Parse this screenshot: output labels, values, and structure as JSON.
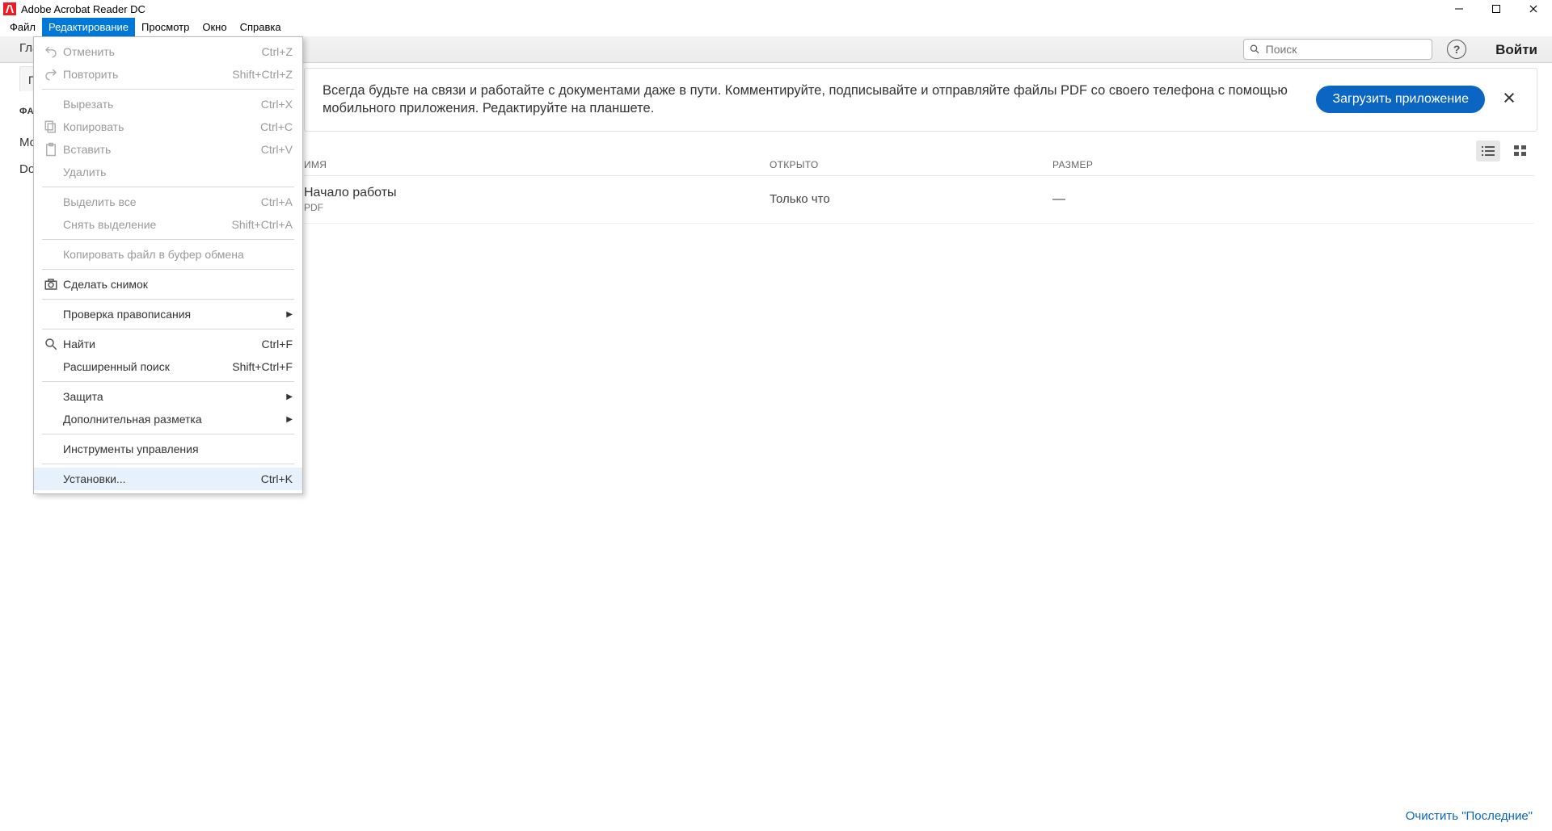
{
  "title": "Adobe Acrobat Reader DC",
  "menubar": [
    "Файл",
    "Редактирование",
    "Просмотр",
    "Окно",
    "Справка"
  ],
  "menubar_active_index": 1,
  "tabs_row": {
    "tab_main": "Главная"
  },
  "search": {
    "placeholder": "Поиск"
  },
  "help_glyph": "?",
  "login_label": "Войти",
  "subtab": "Последние",
  "sidebar": {
    "heading": "ФАЙЛЫ",
    "items": [
      "Мой компьютер",
      "Document Cloud"
    ]
  },
  "banner": {
    "text": "Всегда будьте на связи и работайте с документами даже в пути. Комментируйте, подписывайте и отправляйте файлы PDF со своего телефона с помощью мобильного приложения. Редактируйте на планшете.",
    "button": "Загрузить приложение"
  },
  "table": {
    "headers": {
      "name": "ИМЯ",
      "opened": "ОТКРЫТО",
      "size": "РАЗМЕР"
    },
    "rows": [
      {
        "title": "Начало работы",
        "ext": "PDF",
        "opened": "Только что",
        "size": "—"
      }
    ]
  },
  "clear_link": "Очистить \"Последние\"",
  "dropdown": {
    "groups": [
      [
        {
          "label": "Отменить",
          "shortcut": "Ctrl+Z",
          "icon": "undo",
          "disabled": true
        },
        {
          "label": "Повторить",
          "shortcut": "Shift+Ctrl+Z",
          "icon": "redo",
          "disabled": true
        }
      ],
      [
        {
          "label": "Вырезать",
          "shortcut": "Ctrl+X",
          "disabled": true
        },
        {
          "label": "Копировать",
          "shortcut": "Ctrl+C",
          "icon": "copy",
          "disabled": true
        },
        {
          "label": "Вставить",
          "shortcut": "Ctrl+V",
          "icon": "paste",
          "disabled": true
        },
        {
          "label": "Удалить",
          "shortcut": "",
          "disabled": true
        }
      ],
      [
        {
          "label": "Выделить все",
          "shortcut": "Ctrl+A",
          "disabled": true
        },
        {
          "label": "Снять выделение",
          "shortcut": "Shift+Ctrl+A",
          "disabled": true
        }
      ],
      [
        {
          "label": "Копировать файл в буфер обмена",
          "shortcut": "",
          "disabled": true
        }
      ],
      [
        {
          "label": "Сделать снимок",
          "shortcut": "",
          "icon": "camera"
        }
      ],
      [
        {
          "label": "Проверка правописания",
          "shortcut": "",
          "submenu": true
        }
      ],
      [
        {
          "label": "Найти",
          "shortcut": "Ctrl+F",
          "icon": "search"
        },
        {
          "label": "Расширенный поиск",
          "shortcut": "Shift+Ctrl+F"
        }
      ],
      [
        {
          "label": "Защита",
          "shortcut": "",
          "submenu": true
        },
        {
          "label": "Дополнительная разметка",
          "shortcut": "",
          "submenu": true
        }
      ],
      [
        {
          "label": "Инструменты управления",
          "shortcut": ""
        }
      ],
      [
        {
          "label": "Установки...",
          "shortcut": "Ctrl+K",
          "hover": true
        }
      ]
    ]
  }
}
